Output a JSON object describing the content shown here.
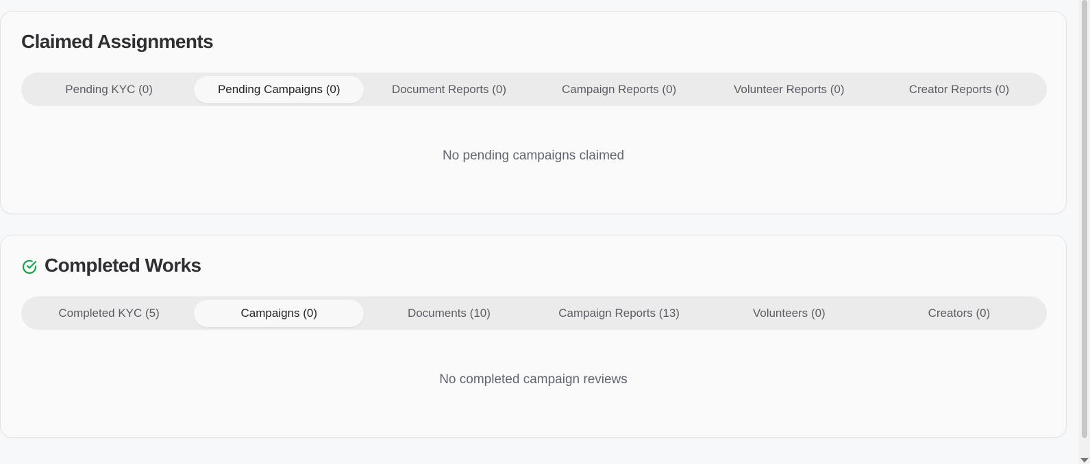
{
  "claimed": {
    "title": "Claimed Assignments",
    "tabs": [
      {
        "label": "Pending KYC (0)",
        "active": false
      },
      {
        "label": "Pending Campaigns (0)",
        "active": true
      },
      {
        "label": "Document Reports (0)",
        "active": false
      },
      {
        "label": "Campaign Reports (0)",
        "active": false
      },
      {
        "label": "Volunteer Reports (0)",
        "active": false
      },
      {
        "label": "Creator Reports (0)",
        "active": false
      }
    ],
    "empty_message": "No pending campaigns claimed"
  },
  "completed": {
    "title": "Completed Works",
    "icon": "check-circle-icon",
    "icon_color": "#16a34a",
    "tabs": [
      {
        "label": "Completed KYC (5)",
        "active": false
      },
      {
        "label": "Campaigns (0)",
        "active": true
      },
      {
        "label": "Documents (10)",
        "active": false
      },
      {
        "label": "Campaign Reports (13)",
        "active": false
      },
      {
        "label": "Volunteers (0)",
        "active": false
      },
      {
        "label": "Creators (0)",
        "active": false
      }
    ],
    "empty_message": "No completed campaign reviews"
  }
}
